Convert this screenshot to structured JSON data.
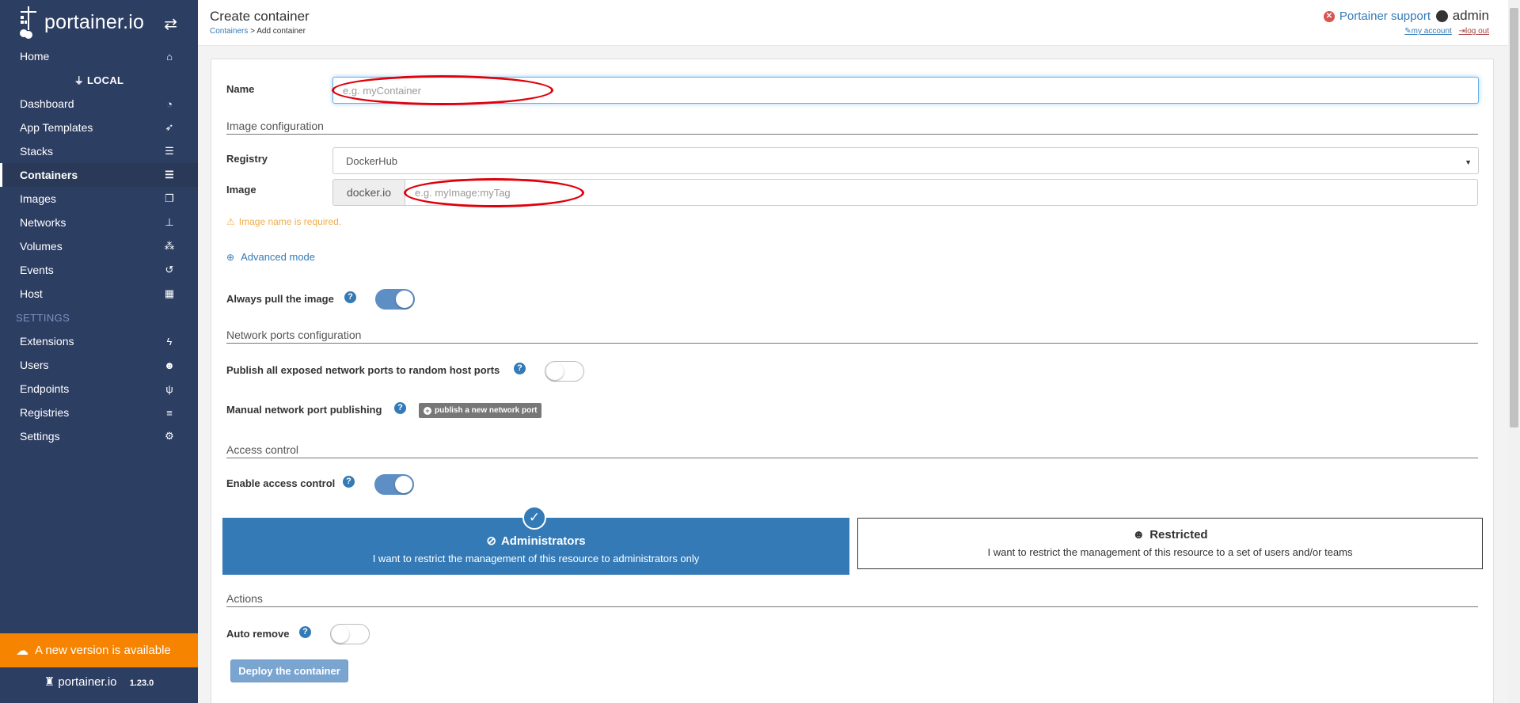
{
  "app": {
    "brand": "portainer.io",
    "version": "1.23.0"
  },
  "sidebar": {
    "home": "Home",
    "endpoint": "LOCAL",
    "items": [
      {
        "label": "Dashboard",
        "icon": "tachometer-icon"
      },
      {
        "label": "App Templates",
        "icon": "rocket-icon"
      },
      {
        "label": "Stacks",
        "icon": "th-list-icon"
      },
      {
        "label": "Containers",
        "icon": "server-icon",
        "active": true
      },
      {
        "label": "Images",
        "icon": "clone-icon"
      },
      {
        "label": "Networks",
        "icon": "sitemap-icon"
      },
      {
        "label": "Volumes",
        "icon": "cubes-icon"
      },
      {
        "label": "Events",
        "icon": "history-icon"
      },
      {
        "label": "Host",
        "icon": "th-icon"
      }
    ],
    "settings_section": "SETTINGS",
    "settings_items": [
      {
        "label": "Extensions",
        "icon": "bolt-icon"
      },
      {
        "label": "Users",
        "icon": "users-icon"
      },
      {
        "label": "Endpoints",
        "icon": "plug-icon"
      },
      {
        "label": "Registries",
        "icon": "database-icon"
      },
      {
        "label": "Settings",
        "icon": "cogs-icon"
      }
    ],
    "update_notice": "A new version is available"
  },
  "header": {
    "title": "Create container",
    "breadcrumb_link": "Containers",
    "breadcrumb_sep": " > ",
    "breadcrumb_current": "Add container",
    "support": "Portainer support",
    "user": "admin",
    "my_account": "my account",
    "log_out": "log out"
  },
  "form": {
    "name_label": "Name",
    "name_placeholder": "e.g. myContainer",
    "image_config_title": "Image configuration",
    "registry_label": "Registry",
    "registry_value": "DockerHub",
    "image_label": "Image",
    "image_prefix": "docker.io",
    "image_placeholder": "e.g. myImage:myTag",
    "image_warning": "Image name is required.",
    "advanced_mode": "Advanced mode",
    "always_pull_label": "Always pull the image",
    "always_pull": true,
    "network_title": "Network ports configuration",
    "publish_all_label": "Publish all exposed network ports to random host ports",
    "publish_all": false,
    "manual_ports_label": "Manual network port publishing",
    "publish_port_button": "publish a new network port",
    "access_title": "Access control",
    "enable_access_label": "Enable access control",
    "enable_access": true,
    "admins_title": "Administrators",
    "admins_desc": "I want to restrict the management of this resource to administrators only",
    "restricted_title": "Restricted",
    "restricted_desc": "I want to restrict the management of this resource to a set of users and/or teams",
    "actions_title": "Actions",
    "auto_remove_label": "Auto remove",
    "auto_remove": false,
    "deploy_button": "Deploy the container"
  },
  "colors": {
    "sidebar_bg": "#2d3e63",
    "accent": "#337ab7",
    "update_bar": "#f68400",
    "warning": "#f0ad4e",
    "annotation_ring": "#e0000b"
  }
}
